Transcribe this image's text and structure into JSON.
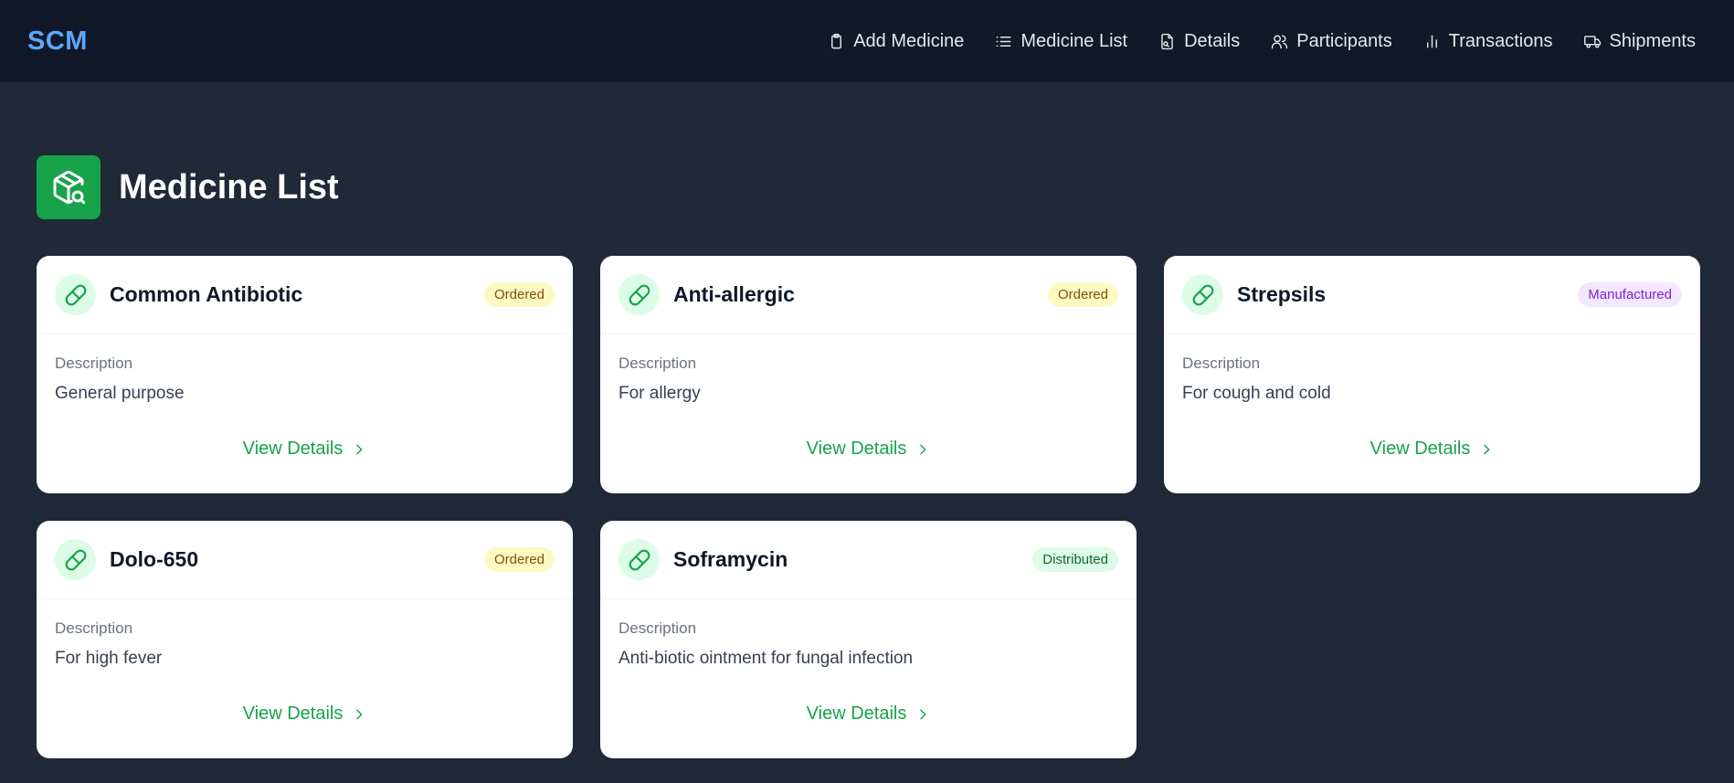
{
  "nav": {
    "brand": "SCM",
    "links": [
      {
        "label": "Add Medicine",
        "icon": "clipboard-icon"
      },
      {
        "label": "Medicine List",
        "icon": "list-icon"
      },
      {
        "label": "Details",
        "icon": "file-search-icon"
      },
      {
        "label": "Participants",
        "icon": "users-icon"
      },
      {
        "label": "Transactions",
        "icon": "bar-chart-icon"
      },
      {
        "label": "Shipments",
        "icon": "truck-icon"
      }
    ]
  },
  "page": {
    "title": "Medicine List",
    "icon": "package-search-icon"
  },
  "medicines": [
    {
      "name": "Common Antibiotic",
      "status": "Ordered",
      "description_label": "Description",
      "description": "General purpose",
      "action": "View Details"
    },
    {
      "name": "Anti-allergic",
      "status": "Ordered",
      "description_label": "Description",
      "description": "For allergy",
      "action": "View Details"
    },
    {
      "name": "Strepsils",
      "status": "Manufactured",
      "description_label": "Description",
      "description": "For cough and cold",
      "action": "View Details"
    },
    {
      "name": "Dolo-650",
      "status": "Ordered",
      "description_label": "Description",
      "description": "For high fever",
      "action": "View Details"
    },
    {
      "name": "Soframycin",
      "status": "Distributed",
      "description_label": "Description",
      "description": "Anti-biotic ointment for fungal infection",
      "action": "View Details"
    }
  ],
  "colors": {
    "background": "#1f2937",
    "navbar": "#111827",
    "brand": "#60a5fa",
    "accent": "#16a34a",
    "ordered_badge": "#fef9c3",
    "manufactured_badge": "#f3e8ff",
    "distributed_badge": "#dcfce7"
  }
}
